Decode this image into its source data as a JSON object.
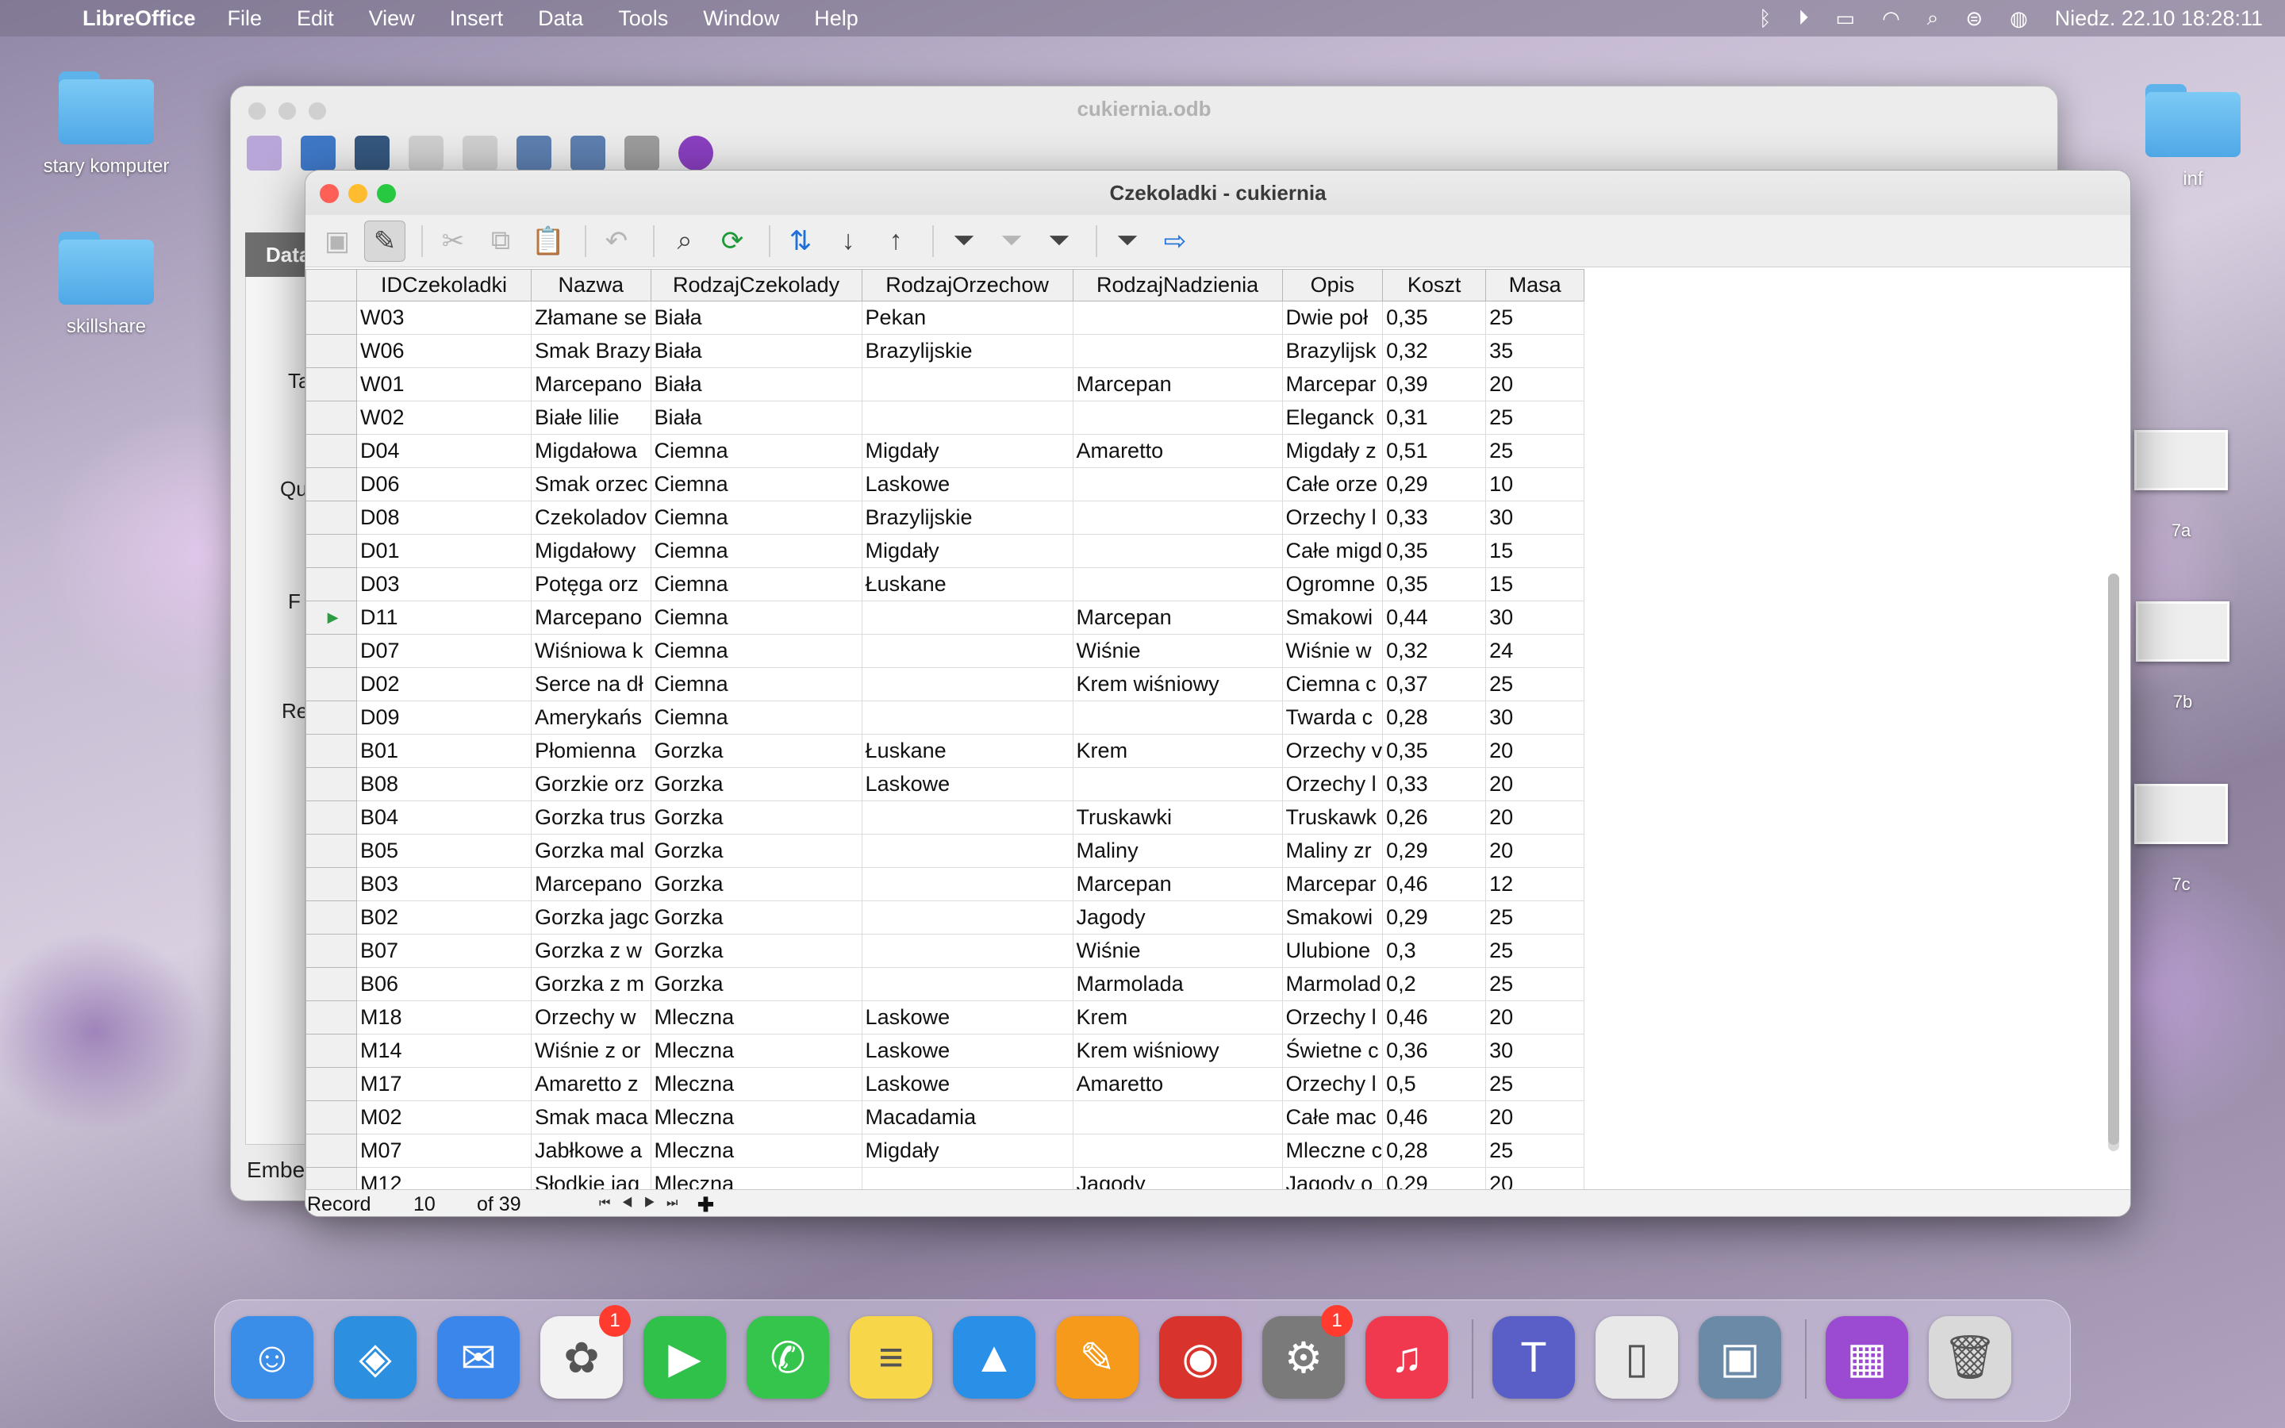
{
  "menubar": {
    "app": "LibreOffice",
    "items": [
      "File",
      "Edit",
      "View",
      "Insert",
      "Data",
      "Tools",
      "Window",
      "Help"
    ],
    "clock": "Niedz. 22.10  18:28:11",
    "status_icons": [
      "bluetooth-icon",
      "play-icon",
      "battery-icon",
      "wifi-icon",
      "search-icon",
      "control-center-icon",
      "siri-icon"
    ]
  },
  "desktop": {
    "icons": [
      {
        "label": "stary komputer"
      },
      {
        "label": "skillshare"
      },
      {
        "label": "inf"
      }
    ],
    "thumbnails": [
      {
        "label": "7a"
      },
      {
        "label": "7b"
      },
      {
        "label": "7c"
      }
    ]
  },
  "background_window": {
    "title": "cukiernia.odb",
    "panel_tab": "Data",
    "side_labels": [
      "Ta",
      "Qu",
      "F",
      "Re"
    ],
    "footer": "Embe"
  },
  "window": {
    "title": "Czekoladki - cukiernia",
    "toolbar": [
      {
        "icon": "save-icon",
        "state": "dim"
      },
      {
        "icon": "edit-icon",
        "state": "active"
      },
      {
        "icon": "cut-icon",
        "state": "dim"
      },
      {
        "icon": "copy-icon",
        "state": "dim"
      },
      {
        "icon": "paste-icon",
        "state": "normal"
      },
      {
        "icon": "undo-icon",
        "state": "dim"
      },
      {
        "icon": "find-icon",
        "state": "normal"
      },
      {
        "icon": "refresh-icon",
        "state": "green"
      },
      {
        "icon": "sort-icon",
        "state": "blue"
      },
      {
        "icon": "sort-ascending-icon",
        "state": "normal"
      },
      {
        "icon": "sort-descending-icon",
        "state": "normal"
      },
      {
        "icon": "autofilter-icon",
        "state": "normal"
      },
      {
        "icon": "standard-filter-icon",
        "state": "dim"
      },
      {
        "icon": "apply-filter-icon",
        "state": "normal"
      },
      {
        "icon": "reset-filter-icon",
        "state": "normal"
      },
      {
        "icon": "data-to-text-icon",
        "state": "blue"
      }
    ],
    "columns": [
      "IDCzekoladki",
      "Nazwa",
      "RodzajCzekolady",
      "RodzajOrzechow",
      "RodzajNadzienia",
      "Opis",
      "Koszt",
      "Masa"
    ],
    "rows": [
      [
        "W03",
        "Złamane se",
        "Biała",
        "Pekan",
        "",
        "Dwie poł",
        "0,35",
        "25"
      ],
      [
        "W06",
        "Smak Brazy",
        "Biała",
        "Brazylijskie",
        "",
        "Brazylijsk",
        "0,32",
        "35"
      ],
      [
        "W01",
        "Marcepano",
        "Biała",
        "",
        "Marcepan",
        "Marcepar",
        "0,39",
        "20"
      ],
      [
        "W02",
        "Białe lilie",
        "Biała",
        "",
        "",
        "Eleganck",
        "0,31",
        "25"
      ],
      [
        "D04",
        "Migdałowa",
        "Ciemna",
        "Migdały",
        "Amaretto",
        "Migdały z",
        "0,51",
        "25"
      ],
      [
        "D06",
        "Smak orzec",
        "Ciemna",
        "Laskowe",
        "",
        "Całe orze",
        "0,29",
        "10"
      ],
      [
        "D08",
        "Czekoladov",
        "Ciemna",
        "Brazylijskie",
        "",
        "Orzechy l",
        "0,33",
        "30"
      ],
      [
        "D01",
        "Migdałowy",
        "Ciemna",
        "Migdały",
        "",
        "Całe migd",
        "0,35",
        "15"
      ],
      [
        "D03",
        "Potęga orz",
        "Ciemna",
        "Łuskane",
        "",
        "Ogromne",
        "0,35",
        "15"
      ],
      [
        "D11",
        "Marcepano",
        "Ciemna",
        "",
        "Marcepan",
        "Smakowi",
        "0,44",
        "30"
      ],
      [
        "D07",
        "Wiśniowa k",
        "Ciemna",
        "",
        "Wiśnie",
        "Wiśnie w",
        "0,32",
        "24"
      ],
      [
        "D02",
        "Serce na dł",
        "Ciemna",
        "",
        "Krem wiśniowy",
        "Ciemna c",
        "0,37",
        "25"
      ],
      [
        "D09",
        "Amerykańs",
        "Ciemna",
        "",
        "",
        "Twarda c",
        "0,28",
        "30"
      ],
      [
        "B01",
        "Płomienna",
        "Gorzka",
        "Łuskane",
        "Krem",
        "Orzechy v",
        "0,35",
        "20"
      ],
      [
        "B08",
        "Gorzkie orz",
        "Gorzka",
        "Laskowe",
        "",
        "Orzechy l",
        "0,33",
        "20"
      ],
      [
        "B04",
        "Gorzka trus",
        "Gorzka",
        "",
        "Truskawki",
        "Truskawk",
        "0,26",
        "20"
      ],
      [
        "B05",
        "Gorzka mal",
        "Gorzka",
        "",
        "Maliny",
        "Maliny zr",
        "0,29",
        "20"
      ],
      [
        "B03",
        "Marcepano",
        "Gorzka",
        "",
        "Marcepan",
        "Marcepar",
        "0,46",
        "12"
      ],
      [
        "B02",
        "Gorzka jagc",
        "Gorzka",
        "",
        "Jagody",
        "Smakowi",
        "0,29",
        "25"
      ],
      [
        "B07",
        "Gorzka z w",
        "Gorzka",
        "",
        "Wiśnie",
        "Ulubione",
        "0,3",
        "25"
      ],
      [
        "B06",
        "Gorzka z m",
        "Gorzka",
        "",
        "Marmolada",
        "Marmolad",
        "0,2",
        "25"
      ],
      [
        "M18",
        "Orzechy w",
        "Mleczna",
        "Laskowe",
        "Krem",
        "Orzechy l",
        "0,46",
        "20"
      ],
      [
        "M14",
        "Wiśnie z or",
        "Mleczna",
        "Laskowe",
        "Krem wiśniowy",
        "Świetne c",
        "0,36",
        "30"
      ],
      [
        "M17",
        "Amaretto z",
        "Mleczna",
        "Laskowe",
        "Amaretto",
        "Orzechy l",
        "0,5",
        "25"
      ],
      [
        "M02",
        "Smak maca",
        "Mleczna",
        "Macadamia",
        "",
        "Całe mac",
        "0,46",
        "20"
      ],
      [
        "M07",
        "Jabłkowe a",
        "Mleczna",
        "Migdały",
        "",
        "Mleczne c",
        "0,28",
        "25"
      ],
      [
        "M12",
        "Słodkie jag",
        "Mleczna",
        "",
        "Jagody",
        "Jagody o",
        "0,29",
        "20"
      ]
    ],
    "current_row_marker": "▶",
    "navigation": {
      "label": "Record",
      "current": "10",
      "of": "of 39"
    }
  },
  "dock": {
    "apps": [
      {
        "name": "finder-icon",
        "color": "#3b8ee8",
        "glyph": "☺"
      },
      {
        "name": "safari-icon",
        "color": "#2d8fe0",
        "glyph": "◈"
      },
      {
        "name": "mail-icon",
        "color": "#3a86ea",
        "glyph": "✉"
      },
      {
        "name": "photos-icon",
        "color": "#f2f2f2",
        "glyph": "✿",
        "badge": "1"
      },
      {
        "name": "facetime-icon",
        "color": "#2fc14a",
        "glyph": "▶"
      },
      {
        "name": "messages-icon",
        "color": "#35c54c",
        "glyph": "✆"
      },
      {
        "name": "notes-icon",
        "color": "#f7d64a",
        "glyph": "≡"
      },
      {
        "name": "keynote-icon",
        "color": "#2a8fe6",
        "glyph": "▲"
      },
      {
        "name": "pages-icon",
        "color": "#f59a1b",
        "glyph": "✎"
      },
      {
        "name": "photo-booth-icon",
        "color": "#d8332c",
        "glyph": "◉"
      },
      {
        "name": "system-settings-icon",
        "color": "#7a7a7a",
        "glyph": "⚙",
        "badge": "1"
      },
      {
        "name": "music-icon",
        "color": "#f0394e",
        "glyph": "♫"
      },
      {
        "name": "teams-icon",
        "color": "#5a5fc8",
        "glyph": "T"
      },
      {
        "name": "libreoffice-icon",
        "color": "#e8e8e8",
        "glyph": "▯"
      },
      {
        "name": "preview-icon",
        "color": "#6a8aa8",
        "glyph": "▣"
      },
      {
        "name": "base-document-icon",
        "color": "#9b4bd1",
        "glyph": "▦"
      },
      {
        "name": "trash-icon",
        "color": "#d9d9d9",
        "glyph": "🗑"
      }
    ]
  }
}
